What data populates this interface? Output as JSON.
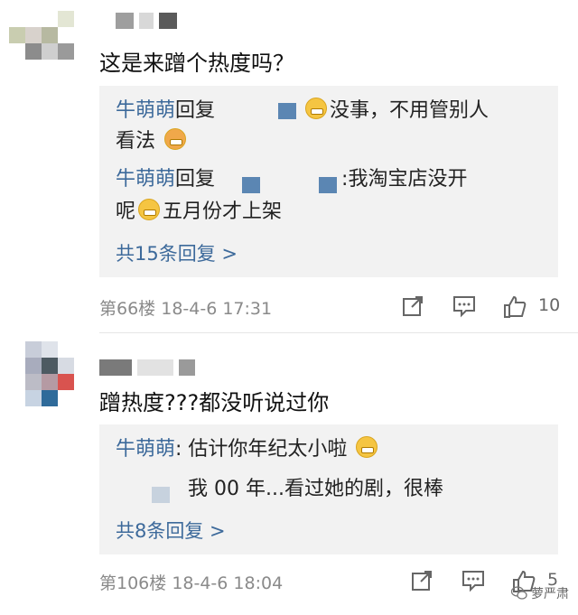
{
  "comments": [
    {
      "text": "这是来蹭个热度吗？",
      "replies": [
        {
          "name": "牛萌萌",
          "verb": "回复",
          "text_a": "没事，不用管别人",
          "text_b": "看法"
        },
        {
          "name": "牛萌萌",
          "verb": "回复",
          "text_a": ":我淘宝店没开",
          "text_b": "呢",
          "text_c": "五月份才上架"
        }
      ],
      "more": "共15条回复 >",
      "floor": "第66楼",
      "time": "18-4-6 17:31",
      "likes": "10"
    },
    {
      "text": "蹭热度???都没听说过你",
      "replies": [
        {
          "name": "牛萌萌",
          "text_a": ": 估计你年纪太小啦"
        },
        {
          "text_a": "我 00 年...看过她的剧，很棒"
        }
      ],
      "more": "共8条回复 >",
      "floor": "第106楼",
      "time": "18-4-6 18:04",
      "likes": "5"
    }
  ],
  "watermark": "萝严肃",
  "colors": {
    "link": "#3d6a9b",
    "reply_bg": "#f2f2f2",
    "meta": "#8a8a8a"
  },
  "icons": [
    "share-icon",
    "comment-icon",
    "like-icon",
    "emoji-grin-icon",
    "emoji-kiss-icon",
    "emoji-thinking-icon",
    "wechat-icon"
  ]
}
